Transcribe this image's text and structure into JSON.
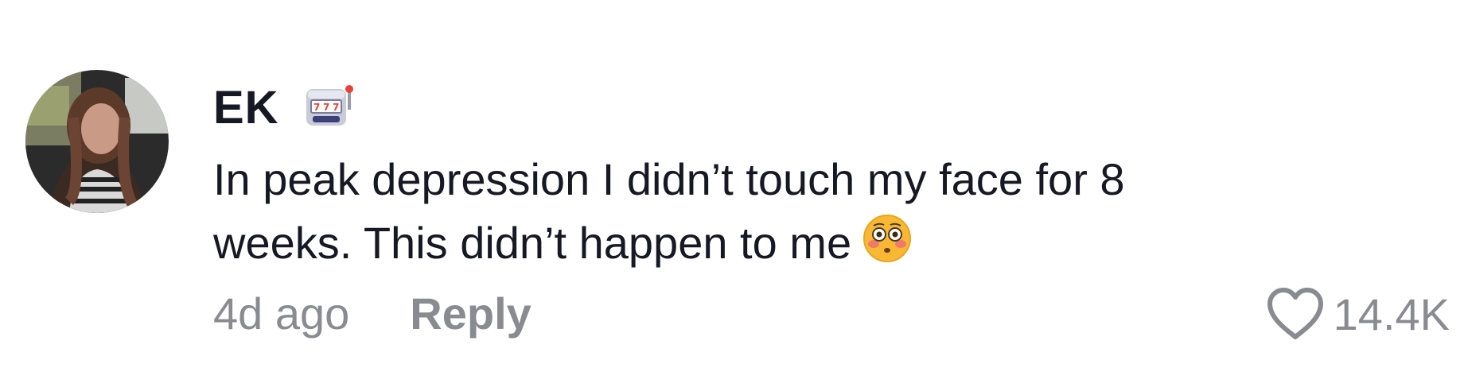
{
  "comment": {
    "author": "EK",
    "author_badge_icon": "slot-machine-icon",
    "text_line1": "In peak depression I didn’t touch my face for 8",
    "text_line2": "weeks. This didn’t happen to me",
    "text_emoji_icon": "flushed-face-icon",
    "time_ago": "4d ago",
    "reply_label": "Reply",
    "like_count": "14.4K"
  },
  "colors": {
    "text_primary": "#161823",
    "text_secondary": "#8a8b91",
    "background": "#ffffff"
  }
}
